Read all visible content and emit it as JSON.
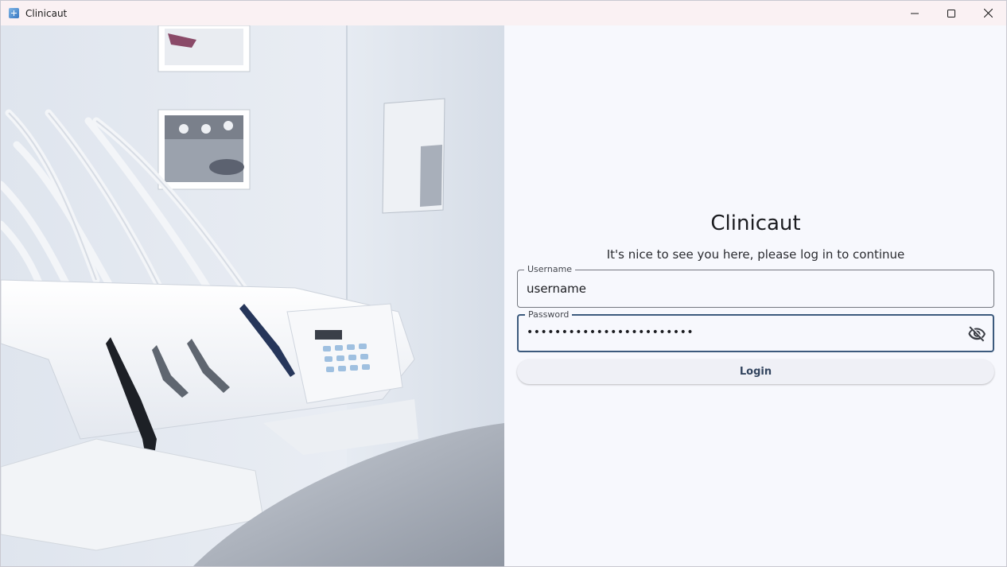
{
  "window": {
    "title": "Clinicaut",
    "icon": "clinic-app-icon",
    "controls": [
      "minimize-icon",
      "maximize-icon",
      "close-icon"
    ]
  },
  "hero_image": {
    "icon": "dental-clinic-photo"
  },
  "login": {
    "heading": "Clinicaut",
    "subtitle": "It's nice to see you here, please log in to continue",
    "username": {
      "label": "Username",
      "value": "username"
    },
    "password": {
      "label": "Password",
      "value": "••••••••••••••••••••••••",
      "toggle_icon": "eye-off-icon"
    },
    "submit_label": "Login"
  },
  "colors": {
    "accent": "#3c5a7d",
    "background": "#f7f8fd",
    "titlebar": "#faf1f3",
    "button_text": "#33455f"
  }
}
